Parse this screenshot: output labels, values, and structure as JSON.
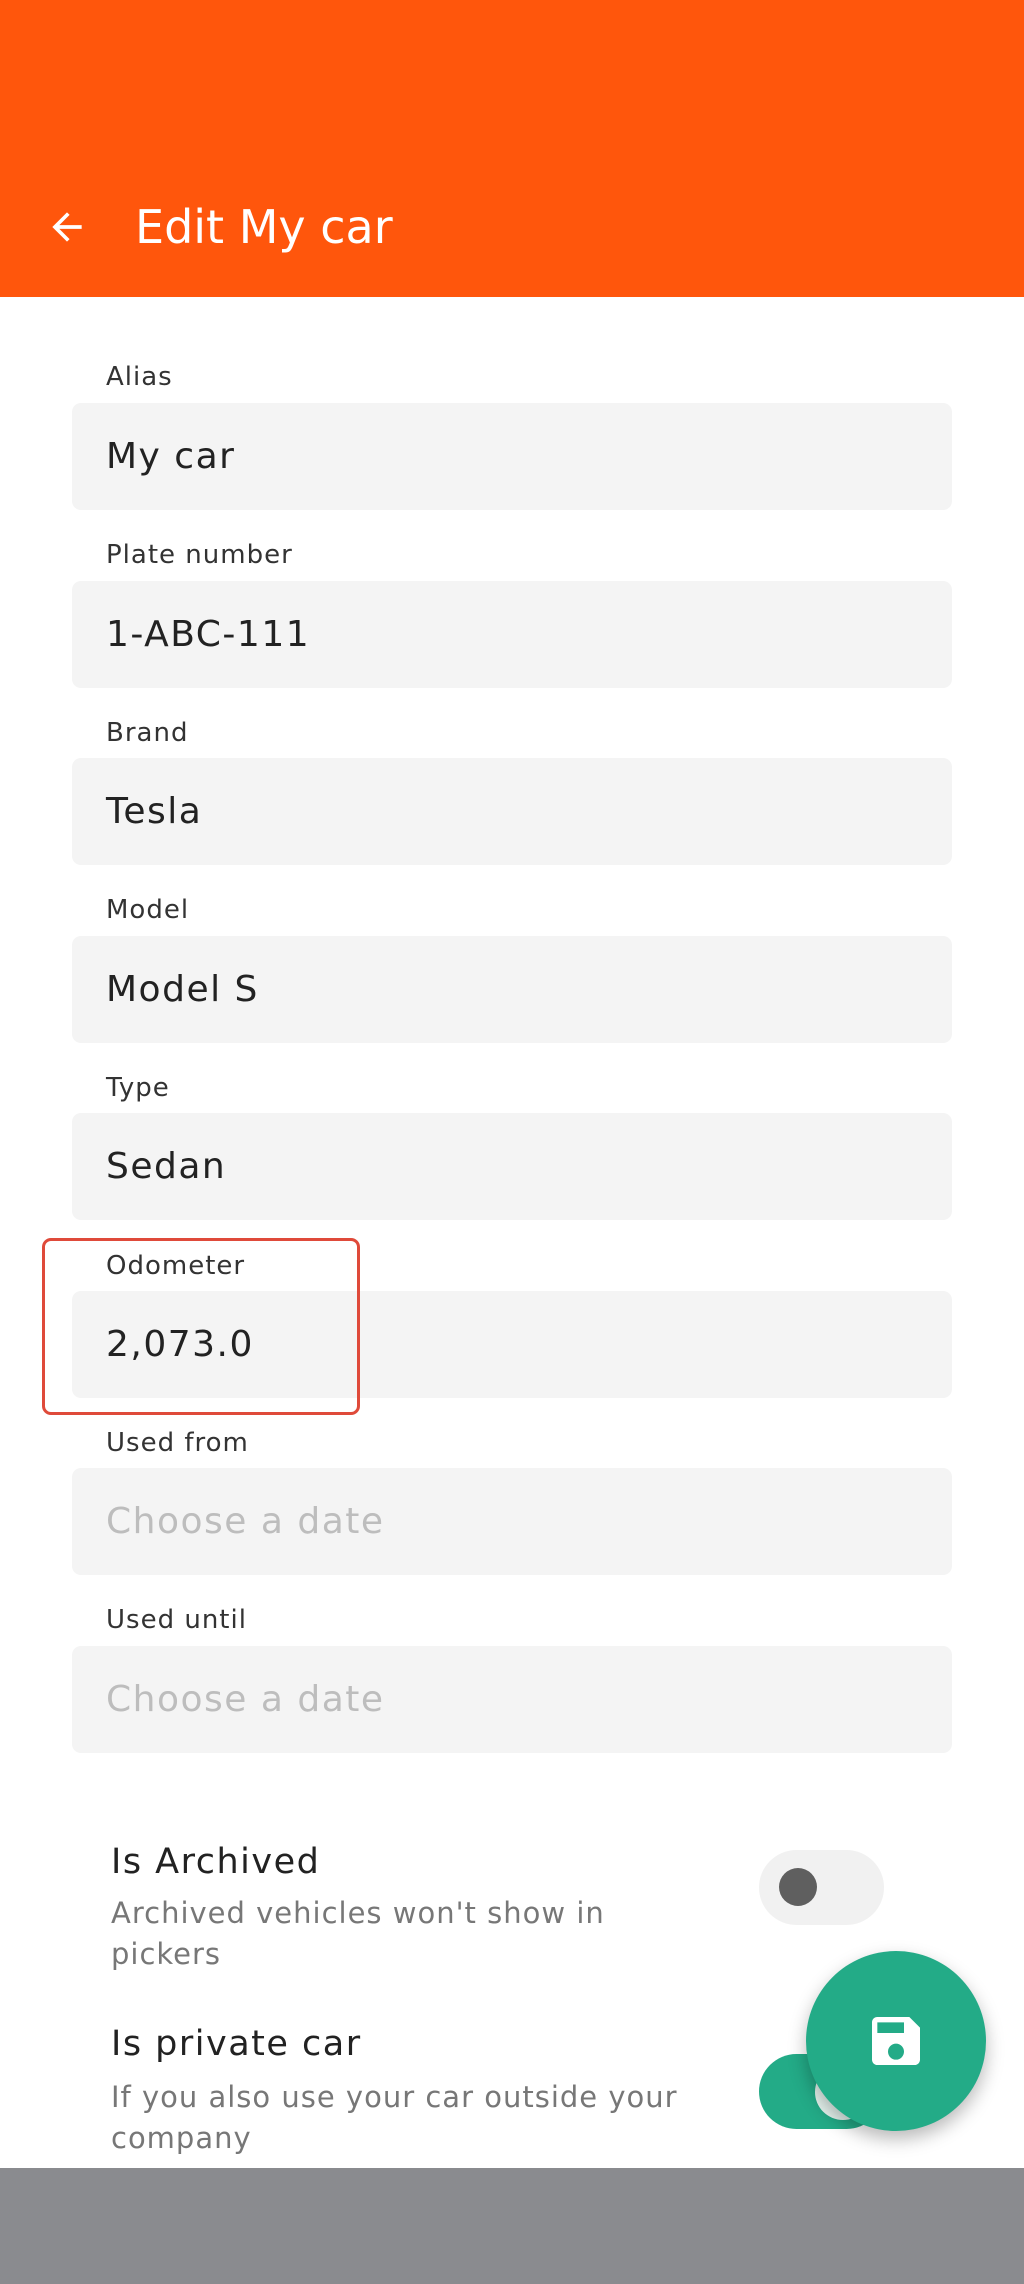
{
  "header": {
    "title": "Edit My car",
    "back_icon": "arrow-left-icon",
    "background": "#ff560c"
  },
  "fields": [
    {
      "label": "Alias",
      "value": "My car"
    },
    {
      "label": "Plate number",
      "value": "1-ABC-111"
    },
    {
      "label": "Brand",
      "value": "Tesla"
    },
    {
      "label": "Model",
      "value": "Model S"
    },
    {
      "label": "Type",
      "value": "Sedan"
    },
    {
      "label": "Odometer",
      "value": "2,073.0"
    },
    {
      "label": "Used from",
      "value": "",
      "placeholder": "Choose a date"
    },
    {
      "label": "Used until",
      "value": "",
      "placeholder": "Choose a date"
    }
  ],
  "settings": {
    "archived": {
      "title": "Is Archived",
      "subtitle": "Archived vehicles won't show in pickers",
      "enabled": false
    },
    "private_car": {
      "title": "Is private car",
      "subtitle": "If you also use your car outside your company",
      "enabled": true
    }
  },
  "fab": {
    "icon": "save-icon",
    "color": "#23ab87"
  },
  "colors": {
    "accent": "#ff560c",
    "success": "#23ab87",
    "highlight": "#df4a3a"
  }
}
